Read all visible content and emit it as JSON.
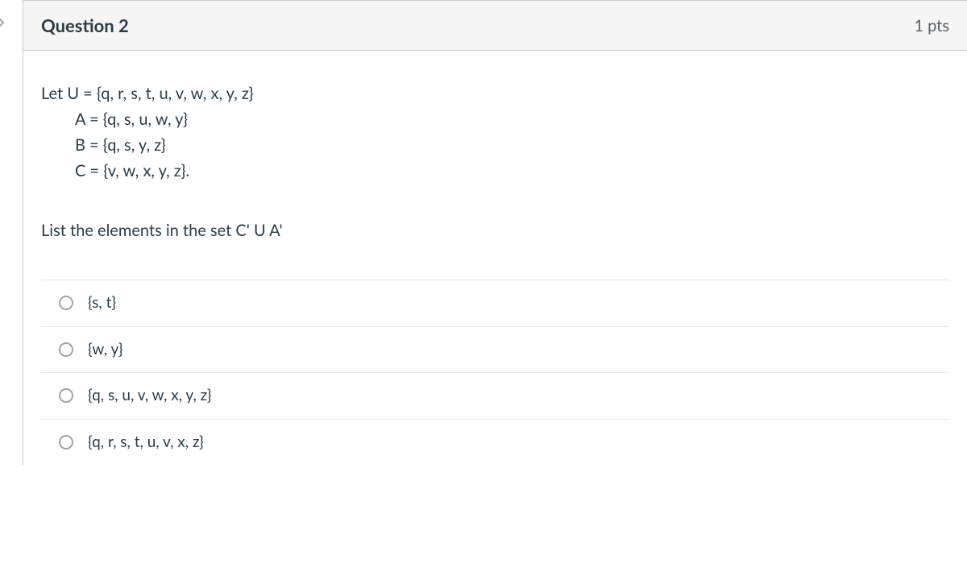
{
  "header": {
    "title": "Question 2",
    "points": "1 pts"
  },
  "stem": {
    "line1": "Let U = {q, r, s, t, u, v, w, x, y, z}",
    "line2": "A = {q, s, u, w, y}",
    "line3": "B = {q, s, y, z}",
    "line4": "C = {v, w, x, y, z}."
  },
  "prompt": "List the elements in the set C' U A'",
  "answers": [
    {
      "label": "{s, t}"
    },
    {
      "label": "{w, y}"
    },
    {
      "label": "{q, s, u, v, w, x, y, z}"
    },
    {
      "label": "{q, r, s, t, u, v, x, z}"
    }
  ]
}
